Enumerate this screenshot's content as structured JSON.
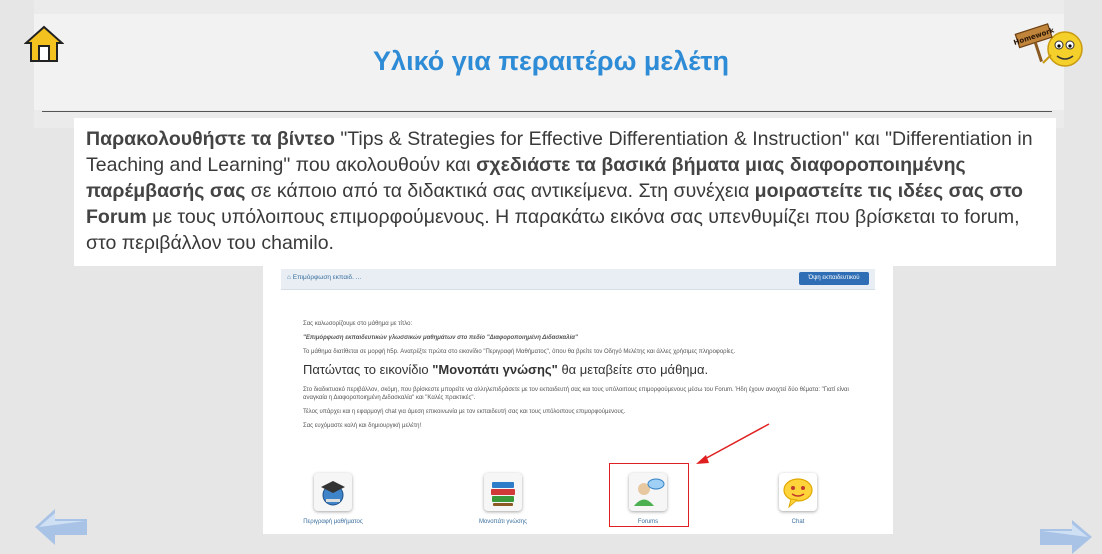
{
  "page": {
    "title": "Υλικό για περαιτέρω μελέτη"
  },
  "instructions": {
    "p1_bold": "Παρακολουθήστε τα  βίντεο",
    "p1_rest": " \"Tips & Strategies for Effective Differentiation & Instruction\" και \"Differentiation in Teaching and Learning\" που ακολουθούν και ",
    "p2_bold": "σχεδιάστε τα βασικά βήματα μιας διαφοροποιημένης παρέμβασής σας",
    "p2_rest": " σε κάποιο από τα διδακτικά σας αντικείμενα. Στη συνέχεια ",
    "p3_bold": "μοιραστείτε τις ιδέες σας στο Forum",
    "p3_rest": " με τους υπόλοιπους επιμορφούμενους. Η παρακάτω εικόνα σας υπενθυμίζει που βρίσκεται το forum, στο περιβάλλον του chamilo."
  },
  "screenshot": {
    "course_title": "Επιμόρφωση εκπαιδ. ...",
    "view_button": "Όψη εκπαιδευτικού",
    "line1": "Σας καλωσορίζουμε στο μάθημα με τίτλο:",
    "line2": "\"Επιμόρφωση εκπαιδευτικών γλωσσικών μαθημάτων στο πεδίο \"Διαφοροποιημένη Διδασκαλία\"",
    "line3": "Το μάθημα διατίθεται σε μορφή h5p. Ανατρέξτε πρώτα στο εικονίδιο \"Περιγραφή Μαθήματος\", όπου θα βρείτε τον Οδηγό Μελέτης και άλλες χρήσιμες πληροφορίες.",
    "big_prefix": "Πατώντας το εικονίδιο ",
    "big_bold": "\"Μονοπάτι γνώσης\"",
    "big_suffix": " θα μεταβείτε στο μάθημα.",
    "line4": "Στο διαδικτυακό περιβάλλον, σκόμη, που βρίσκεστε μπορείτε να αλληλεπιδράσετε με τον εκπαιδευτή σας και τους υπόλοιπους επιμορφούμενους μέσω του Forum. Ήδη έχουν ανοιχτεί δύο θέματα: \"Γιατί είναι αναγκαία η Διαφοροποιημένη Διδασκαλία\" και \"Καλές πρακτικές\".",
    "line5": "Τέλος υπάρχει και η εφαρμογή chat για άμεση επικοινωνία με τον εκπαιδευτή σας και τους υπόλοιπους επιμορφούμενους.",
    "line6": "Σας ευχόμαστε καλή και δημιουργική μελέτη!",
    "tools": [
      {
        "label": "Περιγραφή μαθήματος"
      },
      {
        "label": "Μονοπάτι γνώσης"
      },
      {
        "label": "Forums"
      },
      {
        "label": "Chat"
      }
    ]
  },
  "colors": {
    "title": "#2e8bd6",
    "highlight": "#e02020",
    "link": "#3a6e9e"
  },
  "icons": [
    "home-icon",
    "homework-icon",
    "arrow-left-icon",
    "arrow-right-icon"
  ]
}
